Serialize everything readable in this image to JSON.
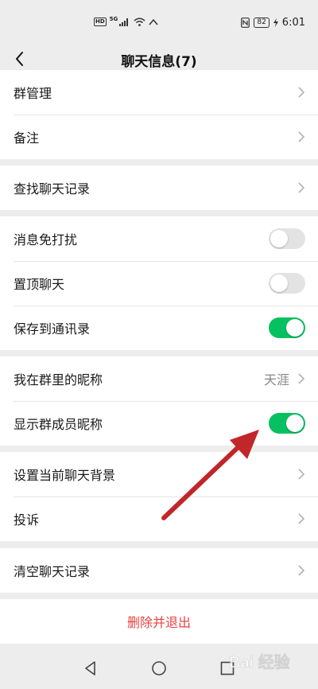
{
  "status_bar": {
    "hd": "HD",
    "net": "5G",
    "battery": "82",
    "time": "6:01"
  },
  "header": {
    "title": "聊天信息(7)"
  },
  "settings": {
    "group_manage": "群管理",
    "remark": "备注",
    "search_history": "查找聊天记录",
    "mute": "消息免打扰",
    "pin": "置顶聊天",
    "save_contacts": "保存到通讯录",
    "my_nickname": "我在群里的昵称",
    "my_nickname_value": "天涯",
    "show_nicknames": "显示群成员昵称",
    "set_background": "设置当前聊天背景",
    "complain": "投诉",
    "clear_history": "清空聊天记录",
    "delete_exit": "删除并退出"
  },
  "toggles": {
    "mute": false,
    "pin": false,
    "save_contacts": true,
    "show_nicknames": true
  },
  "watermark": {
    "text": "Bai 经验"
  },
  "colors": {
    "accent_green": "#07c160",
    "danger_red": "#e64340",
    "arrow_red": "#c0262a"
  }
}
